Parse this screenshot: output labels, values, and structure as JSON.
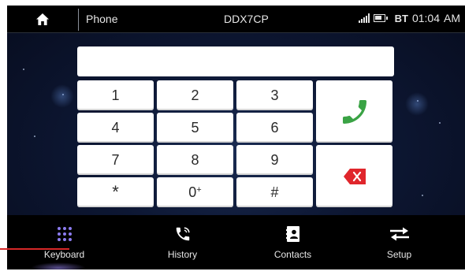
{
  "topbar": {
    "title": "Phone",
    "device": "DDX7CP",
    "bt_label": "BT",
    "time": "01:04",
    "ampm": "AM"
  },
  "keypad": {
    "keys": [
      "1",
      "2",
      "3",
      "4",
      "5",
      "6",
      "7",
      "8",
      "9",
      "*",
      "0",
      "#"
    ],
    "zero_sup": "+"
  },
  "bottom_nav": {
    "items": [
      "Keyboard",
      "History",
      "Contacts",
      "Setup"
    ],
    "active": "Keyboard"
  },
  "colors": {
    "call_green": "#3aa345",
    "delete_red": "#e0262c",
    "active_accent": "#8c7cf0"
  }
}
